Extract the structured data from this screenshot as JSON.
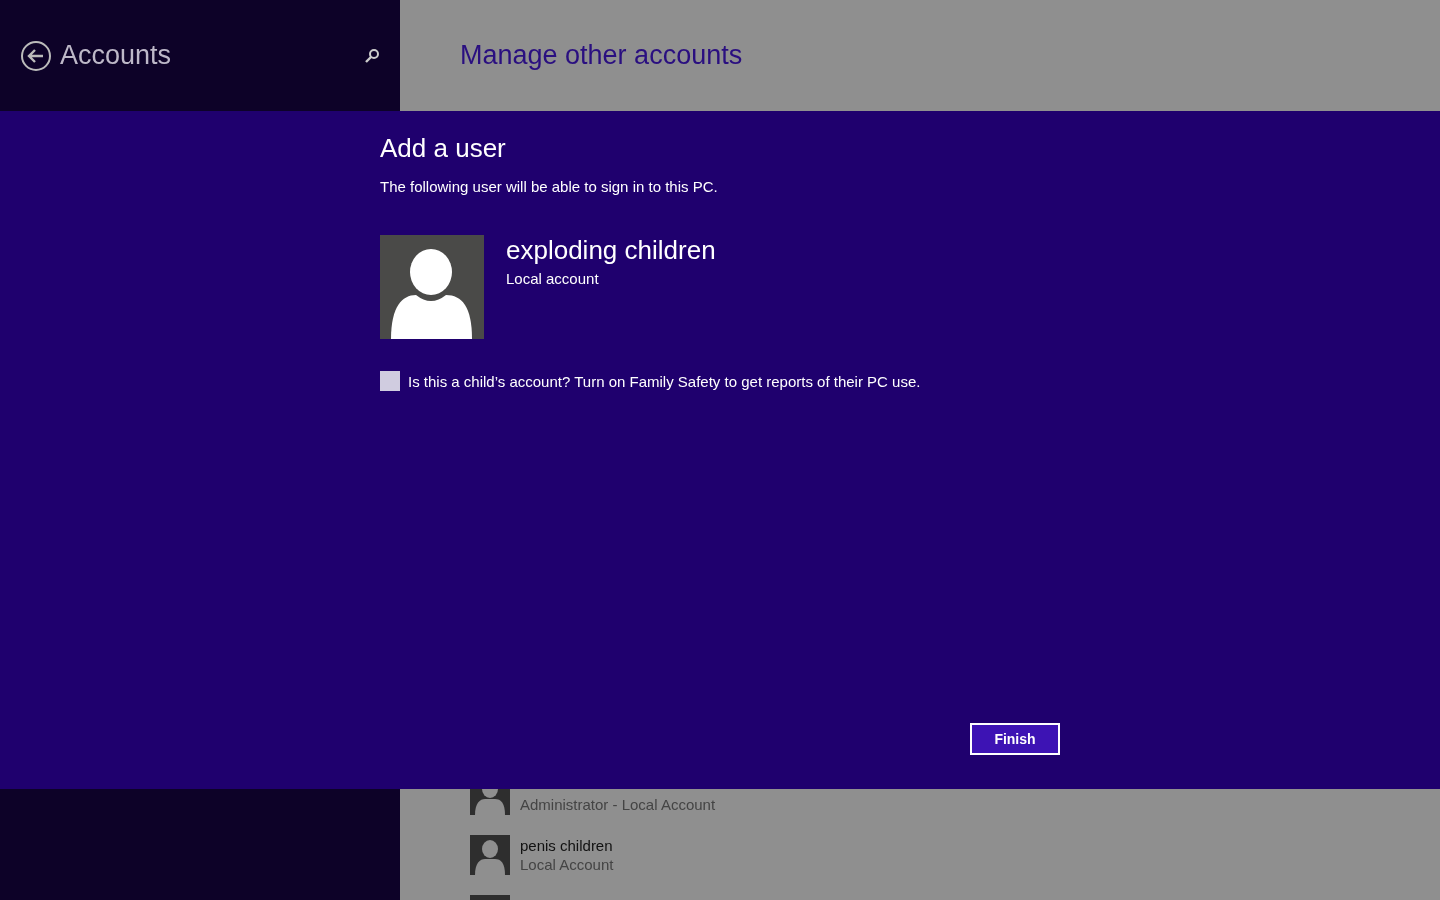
{
  "header": {
    "title": "Accounts",
    "page_title": "Manage other accounts"
  },
  "dialog": {
    "title": "Add a user",
    "description": "The following user will be able to sign in to this PC.",
    "user": {
      "name": "exploding children",
      "type": "Local account"
    },
    "child_checkbox": {
      "label": "Is this a child’s account? Turn on Family Safety to get reports of their PC use.",
      "checked": false
    },
    "buttons": [
      "Finish"
    ]
  },
  "accounts": [
    {
      "role": "Administrator - Local Account"
    },
    {
      "name": "penis children",
      "role": "Local Account"
    }
  ]
}
